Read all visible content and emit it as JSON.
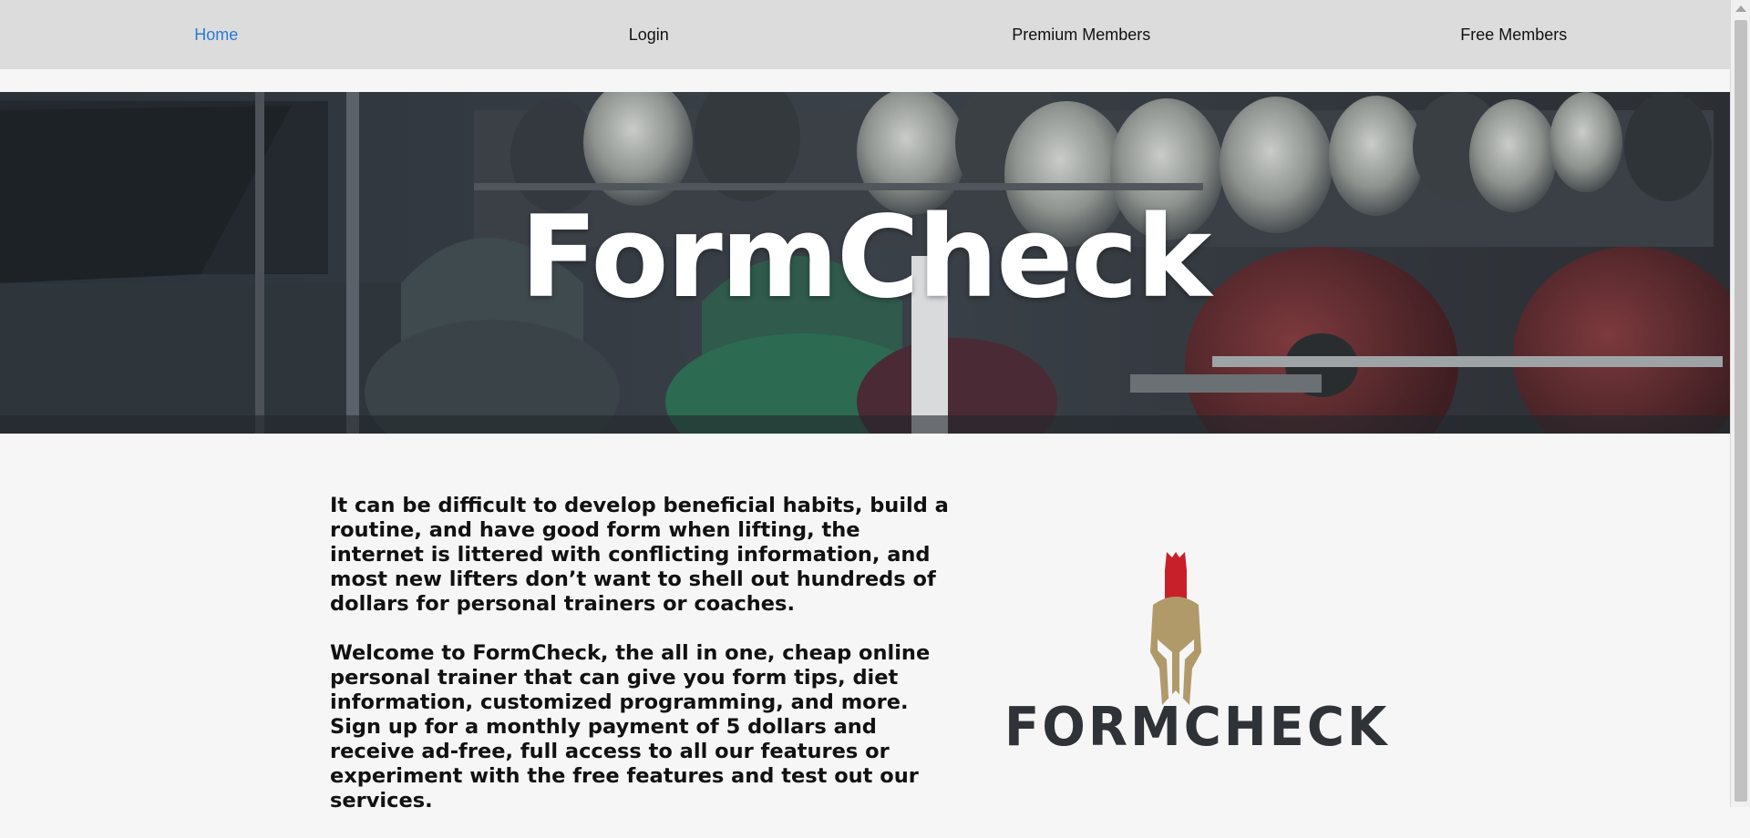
{
  "nav": {
    "items": [
      {
        "label": "Home",
        "active": true
      },
      {
        "label": "Login",
        "active": false
      },
      {
        "label": "Premium Members",
        "active": false
      },
      {
        "label": "Free Members",
        "active": false
      }
    ]
  },
  "hero": {
    "title": "FormCheck",
    "background_icon": "gym-dumbbell-rack-photo"
  },
  "main": {
    "paragraphs": [
      "It can be difficult to develop beneficial habits, build a routine, and have good form when lifting, the internet is littered with conflicting information, and most new lifters don’t want to shell out hundreds of dollars for personal trainers or coaches.",
      "Welcome to FormCheck, the all in one, cheap online personal trainer that can give you form tips, diet information, customized programming, and more. Sign up for a monthly payment of 5 dollars and receive ad-free, full access to all our features or experiment with the free features and test out our services."
    ]
  },
  "logo": {
    "icon": "spartan-helmet-icon",
    "wordmark": "FORMCHECK"
  },
  "colors": {
    "nav_bg": "#dcdcdc",
    "nav_active": "#2a7ad6",
    "page_bg": "#f6f6f6",
    "helmet_gold": "#b09a6a",
    "plume_red": "#c8202a",
    "wordmark": "#2f3338"
  }
}
